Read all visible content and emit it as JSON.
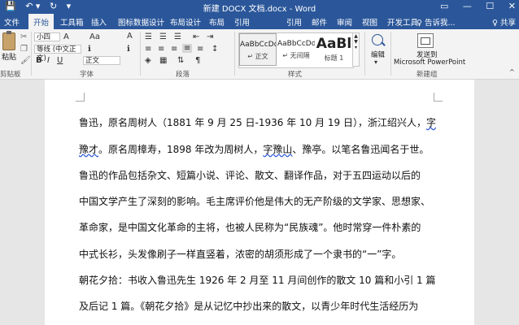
{
  "titlebar": {
    "title": "新建 DOCX 文档.docx - Word",
    "qat": [
      "💾",
      "↶ ▾",
      "↻",
      "▾"
    ],
    "controls": [
      "▭",
      "—",
      "☐",
      "✕"
    ]
  },
  "tabs": {
    "items": [
      "文件",
      "开始",
      "工具箱",
      "插入",
      "图标数据设计",
      "布局设计",
      "布局",
      "引用",
      "邮件",
      "审阅",
      "视图",
      "开发工具"
    ],
    "active": "开始",
    "tellme": "♀ 告诉我...",
    "share": "♀ 共享"
  },
  "ribbon": {
    "clipboard": {
      "paste": "粘贴",
      "label": "剪贴板"
    },
    "font": {
      "font_name": "小四",
      "font_name2": "等线 (中文正文)",
      "font_name3": "正文",
      "size": "A",
      "label": "字体"
    },
    "paragraph": {
      "label": "段落"
    },
    "styles": {
      "items": [
        {
          "preview": "AaBbCcDd",
          "name": "↵ 正文"
        },
        {
          "preview": "AaBbCcDd",
          "name": "↵ 无间隔"
        },
        {
          "preview": "AaBl",
          "name": "标题 1"
        }
      ],
      "label": "样式"
    },
    "editing": {
      "label": "编辑"
    },
    "newgroup": {
      "button1": "发送到",
      "button2": "Microsoft PowerPoint",
      "label": "新建组"
    }
  },
  "document": {
    "lines": [
      {
        "parts": [
          "鲁迅，原名周树人（1881 年 9 月 25 日-1936 年 10 月 19 日），浙江绍兴人，",
          "字"
        ]
      },
      {
        "parts": [
          "豫才",
          "。原名周樟寿，1898 年改为周树人，",
          "字豫山",
          "、豫亭。以笔名鲁迅闻名于世。"
        ]
      },
      {
        "parts": [
          "鲁迅的作品包括杂文、短篇小说、评论、散文、翻译作品，对于五四运动以后的"
        ]
      },
      {
        "parts": [
          "中国文学产生了深刻的影响。毛主席评价他是伟大的无产阶级的文学家、思想家、"
        ]
      },
      {
        "parts": [
          "革命家，是中国文化革命的主将，也被人民称为“民族魂”。他时常穿一件朴素的"
        ]
      },
      {
        "parts": [
          "中式长衫，头发像刷子一样直竖着，浓密的胡须形成了一个隶书的“一”字。"
        ]
      },
      {
        "parts": [
          "朝花夕拾：书收入鲁迅先生 1926 年 2 月至 11 月间创作的散文 10 篇和小引 1 篇"
        ]
      },
      {
        "parts": [
          "及后记 1 篇。《朝花夕拾》是从记忆中抄出来的散文，以青少年时代生活经历为"
        ]
      }
    ]
  }
}
